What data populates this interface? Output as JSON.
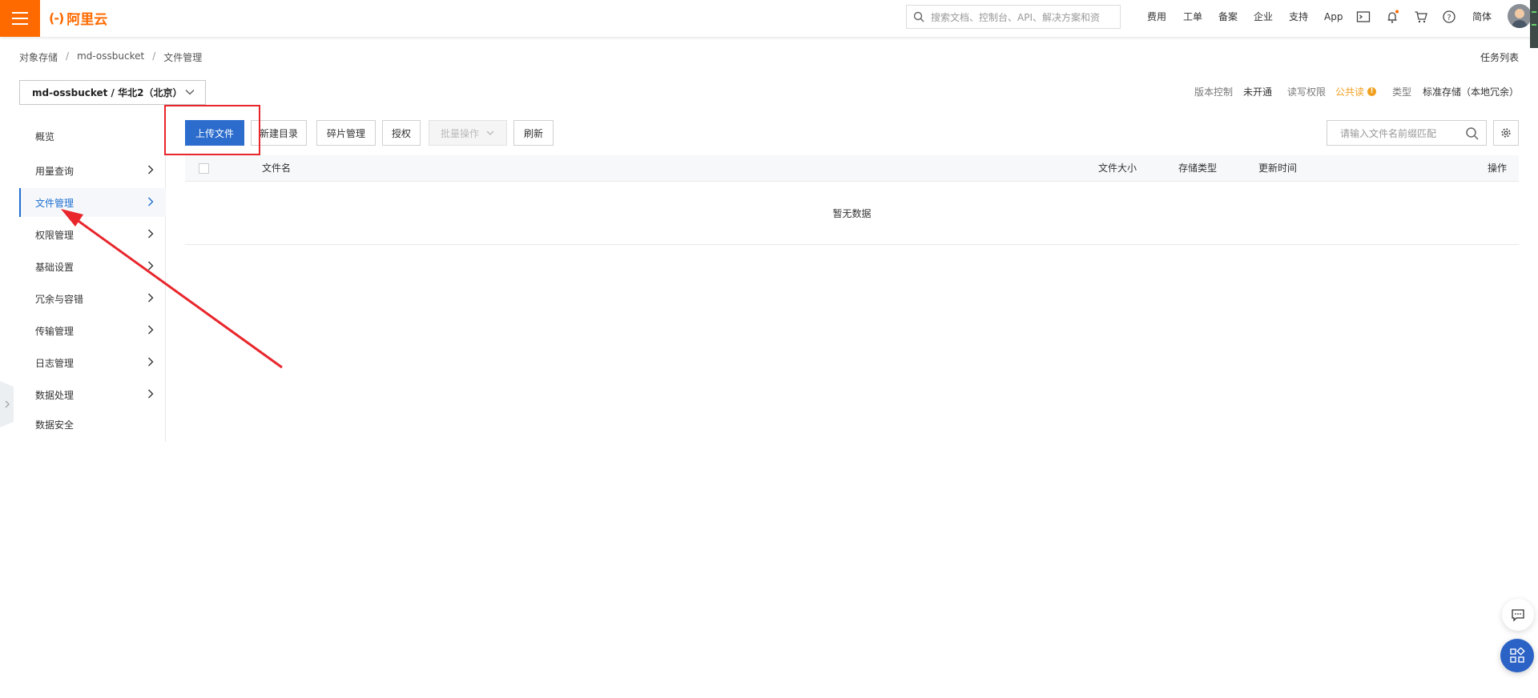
{
  "colors": {
    "brand": "#ff6a00",
    "primary": "#2b6ccd",
    "active_nav": "#1f6fd0",
    "warning": "#f0a020",
    "annotation": "#e8262c"
  },
  "header": {
    "logo_text": "阿里云",
    "search_placeholder": "搜索文档、控制台、API、解决方案和资",
    "nav": [
      "费用",
      "工单",
      "备案",
      "企业",
      "支持",
      "App"
    ],
    "lang": "简体",
    "icons": [
      "menu-icon",
      "search-icon",
      "terminal-icon",
      "bell-icon",
      "cart-icon",
      "help-icon",
      "avatar"
    ]
  },
  "breadcrumb": [
    "对象存储",
    "md-ossbucket",
    "文件管理"
  ],
  "task_list": "任务列表",
  "bucket_selector": {
    "value": "md-ossbucket / 华北2（北京）"
  },
  "bucket_meta": {
    "version_label": "版本控制",
    "version_value": "未开通",
    "acl_label": "读写权限",
    "acl_value": "公共读",
    "type_label": "类型",
    "type_value": "标准存储（本地冗余）"
  },
  "sidebar": {
    "items": [
      {
        "label": "概览",
        "has_arrow": false,
        "active": false
      },
      {
        "label": "用量查询",
        "has_arrow": true,
        "active": false
      },
      {
        "label": "文件管理",
        "has_arrow": true,
        "active": true
      },
      {
        "label": "权限管理",
        "has_arrow": true,
        "active": false
      },
      {
        "label": "基础设置",
        "has_arrow": true,
        "active": false
      },
      {
        "label": "冗余与容错",
        "has_arrow": true,
        "active": false
      },
      {
        "label": "传输管理",
        "has_arrow": true,
        "active": false
      },
      {
        "label": "日志管理",
        "has_arrow": true,
        "active": false
      },
      {
        "label": "数据处理",
        "has_arrow": true,
        "active": false
      },
      {
        "label": "数据安全",
        "has_arrow": false,
        "active": false
      }
    ]
  },
  "toolbar": {
    "upload": "上传文件",
    "new_dir": "新建目录",
    "fragments": "碎片管理",
    "authorize": "授权",
    "batch": "批量操作",
    "refresh": "刷新"
  },
  "file_search": {
    "placeholder": "请输入文件名前缀匹配"
  },
  "table": {
    "columns": [
      "文件名",
      "文件大小",
      "存储类型",
      "更新时间",
      "操作"
    ],
    "empty_text": "暂无数据"
  }
}
